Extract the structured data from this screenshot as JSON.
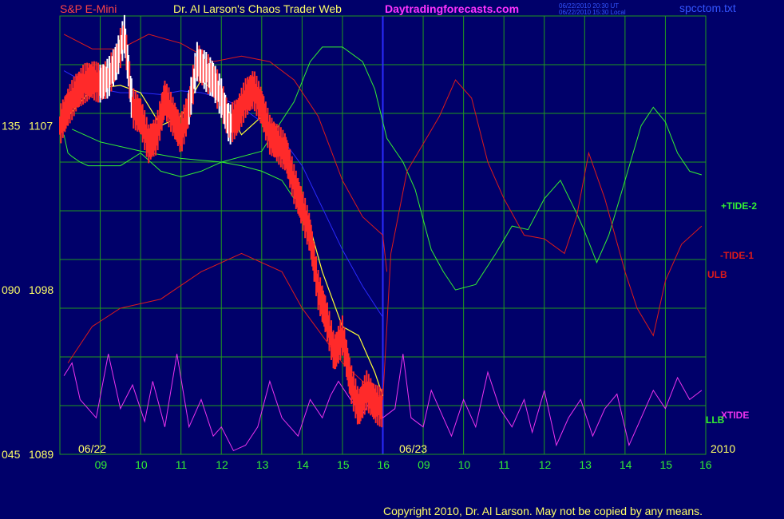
{
  "header": {
    "symbol": "S&P E-Mini",
    "title": "Dr. Al Larson's Chaos Trader Web",
    "site": "Daytradingforecasts.com",
    "stamp_ut": "06/22/2010 20:30 UT",
    "stamp_local": "06/22/2010 15:30 Local",
    "file": "spcctom.txt"
  },
  "footer": {
    "copyright": "Copyright 2010, Dr. Al Larson. May not be copied by any means."
  },
  "colors": {
    "background": "#00006a",
    "grid": "#1f9a1f",
    "frame": "#2a2aff",
    "price": "#ff2a2a",
    "price_up": "#ffffff",
    "yellow": "#ffff33",
    "green": "#33ee33",
    "red": "#dd1a1a",
    "blue": "#2a2aff",
    "magenta": "#ee33ee",
    "header_red": "#ff4444",
    "header_yellow": "#ffff66",
    "header_magenta": "#ff33ff",
    "header_blue": "#3355ff"
  },
  "chart_data": {
    "type": "line",
    "y_ticks": [
      {
        "left": "135",
        "right": "1107"
      },
      {
        "left": "090",
        "right": "1098"
      },
      {
        "left": "045",
        "right": "1089"
      }
    ],
    "y_range": [
      1089,
      1113
    ],
    "x_ticks": [
      "09",
      "10",
      "11",
      "12",
      "13",
      "14",
      "15",
      "16",
      "09",
      "10",
      "11",
      "12",
      "13",
      "14",
      "15",
      "16"
    ],
    "date_labels": [
      "06/22",
      "06/23"
    ],
    "year_label": "2010",
    "series_labels": [
      {
        "text": "+TIDE-2",
        "color": "green"
      },
      {
        "text": "-TIDE-1",
        "color": "red"
      },
      {
        "text": "ULB",
        "color": "red"
      },
      {
        "text": "XTIDE",
        "color": "magenta"
      },
      {
        "text": "LLB",
        "color": "green"
      }
    ],
    "x_range": [
      0,
      16
    ],
    "series": [
      {
        "name": "+TIDE-2",
        "color": "green",
        "x": [
          0.3,
          1,
          2,
          3,
          4,
          5,
          5.8,
          6.2,
          6.5,
          7,
          7.5,
          7.8,
          8.1,
          8.5,
          8.8,
          9.2,
          9.5,
          9.8,
          10.3,
          10.8,
          11.2,
          11.6,
          12.0,
          12.4,
          12.8,
          13.0,
          13.3,
          13.6,
          14.0,
          14.4,
          14.7,
          15.0,
          15.3,
          15.6,
          15.9
        ],
        "y": [
          1106.8,
          1106.1,
          1105.6,
          1105.2,
          1105.0,
          1105.6,
          1108.3,
          1110.5,
          1111.3,
          1111.3,
          1110.5,
          1109.0,
          1106.3,
          1105.0,
          1103.5,
          1100.2,
          1099.0,
          1098.0,
          1098.3,
          1100.0,
          1101.5,
          1101.3,
          1103.0,
          1104.0,
          1102.2,
          1101.2,
          1099.5,
          1101.0,
          1104.0,
          1107.0,
          1108.0,
          1107.2,
          1105.5,
          1104.5,
          1104.3
        ]
      },
      {
        "name": "-TIDE-1",
        "color": "red",
        "x": [
          0.2,
          0.8,
          1.5,
          2.5,
          3.5,
          4.5,
          5.5,
          6,
          6.5,
          7,
          7.5,
          8,
          8.2,
          8.6,
          9.0,
          9.4,
          9.8,
          10.2,
          10.6,
          11.0,
          11.5,
          12.0,
          12.5,
          12.8,
          13.1,
          13.5,
          14.0,
          14.3,
          14.7,
          15.0,
          15.4,
          15.9
        ],
        "y": [
          1094.0,
          1096.0,
          1097.0,
          1097.5,
          1099.0,
          1100.0,
          1099.0,
          1097.0,
          1095.5,
          1094.0,
          1093.0,
          1092.0,
          1100.0,
          1104.5,
          1106.0,
          1107.5,
          1109.5,
          1108.5,
          1105.0,
          1103.0,
          1101.0,
          1100.8,
          1100.0,
          1102.0,
          1105.5,
          1103.0,
          1099.0,
          1097.0,
          1095.5,
          1098.5,
          1100.5,
          1101.5
        ]
      },
      {
        "name": "ULB",
        "color": "red",
        "x": [
          0.1,
          0.8,
          1.5,
          2.2,
          3.0,
          3.8,
          4.5,
          5.2,
          5.8,
          6.4,
          7.0,
          7.5,
          8.0,
          8.1
        ],
        "y": [
          1112.0,
          1111.2,
          1111.2,
          1112.0,
          1111.5,
          1110.5,
          1110.8,
          1110.5,
          1109.5,
          1107.5,
          1104.0,
          1102.0,
          1101.0,
          1099.0
        ]
      },
      {
        "name": "LLB",
        "color": "green",
        "x": [
          0.1,
          0.2,
          0.3,
          0.5,
          0.7,
          1,
          1.5,
          2.0,
          2.5,
          3.0,
          3.5,
          4.0,
          4.5,
          5.0,
          5.5,
          5.8
        ],
        "y": [
          1106.5,
          1105.5,
          1105.3,
          1105.0,
          1104.8,
          1104.8,
          1104.8,
          1105.5,
          1104.5,
          1104.2,
          1104.5,
          1105.0,
          1104.8,
          1104.5,
          1104.0,
          1103.0
        ]
      },
      {
        "name": "blue",
        "color": "blue",
        "x": [
          0.1,
          0.5,
          1,
          1.5,
          2,
          2.5,
          3,
          3.5,
          4,
          4.5,
          5,
          5.5,
          6,
          6.5,
          7,
          7.5,
          8
        ],
        "y": [
          1110.0,
          1109.5,
          1109.0,
          1108.8,
          1108.8,
          1108.7,
          1108.9,
          1108.8,
          1108.5,
          1108.0,
          1107.2,
          1106.3,
          1104.8,
          1102.5,
          1100.2,
          1098.2,
          1096.5
        ]
      },
      {
        "name": "XTIDE",
        "color": "magenta",
        "x": [
          0.1,
          0.3,
          0.5,
          0.9,
          1.2,
          1.5,
          1.8,
          2.1,
          2.3,
          2.6,
          2.9,
          3.2,
          3.5,
          3.8,
          4.0,
          4.3,
          4.6,
          4.9,
          5.2,
          5.5,
          5.9,
          6.2,
          6.5,
          6.7,
          6.9,
          7.2,
          7.5,
          7.8,
          8.0,
          8.3,
          8.5,
          8.7,
          9.0,
          9.2,
          9.5,
          9.7,
          10.0,
          10.3,
          10.6,
          10.9,
          11.2,
          11.5,
          11.7,
          12.0,
          12.3,
          12.6,
          12.9,
          13.2,
          13.5,
          13.8,
          14.1,
          14.4,
          14.7,
          15.0,
          15.3,
          15.6,
          15.9
        ],
        "y": [
          1093.3,
          1094.0,
          1092.0,
          1091.0,
          1094.5,
          1091.5,
          1092.8,
          1090.8,
          1093.0,
          1090.5,
          1094.5,
          1090.5,
          1092.0,
          1090.0,
          1090.5,
          1089.2,
          1089.5,
          1090.5,
          1093.0,
          1091.0,
          1090.0,
          1092.0,
          1091.0,
          1092.2,
          1093.0,
          1092.0,
          1091.2,
          1092.3,
          1091.0,
          1091.5,
          1094.5,
          1091.0,
          1090.5,
          1092.5,
          1091.0,
          1090.0,
          1092.0,
          1090.5,
          1093.5,
          1091.5,
          1090.5,
          1092.0,
          1090.2,
          1092.5,
          1089.5,
          1091.0,
          1092.0,
          1090.0,
          1091.5,
          1092.3,
          1089.5,
          1091.0,
          1092.5,
          1091.5,
          1093.2,
          1092.0,
          1092.5
        ]
      },
      {
        "name": "price_avg",
        "color": "yellow",
        "x": [
          0.2,
          0.8,
          1.5,
          2.0,
          2.5,
          3.0,
          3.5,
          4.0,
          4.5,
          5.0,
          5.5,
          6.0,
          6.5,
          7.0,
          7.4,
          7.8,
          8.0
        ],
        "y": [
          1107.5,
          1109.0,
          1109.2,
          1108.8,
          1107.0,
          1107.5,
          1109.5,
          1108.5,
          1106.5,
          1107.5,
          1105.5,
          1103.0,
          1099.0,
          1096.0,
          1095.5,
          1093.5,
          1092.2
        ]
      }
    ],
    "price": {
      "x": [
        0,
        0.2,
        0.4,
        0.6,
        0.8,
        1.0,
        1.2,
        1.4,
        1.6,
        1.8,
        2.0,
        2.2,
        2.4,
        2.6,
        2.8,
        3.0,
        3.2,
        3.4,
        3.6,
        3.8,
        4.0,
        4.2,
        4.4,
        4.6,
        4.8,
        5.0,
        5.2,
        5.4,
        5.6,
        5.8,
        6.0,
        6.2,
        6.4,
        6.6,
        6.8,
        7.0,
        7.2,
        7.4,
        7.6,
        7.8,
        8.0
      ],
      "y": [
        1107.0,
        1108.0,
        1108.8,
        1109.3,
        1109.5,
        1109.3,
        1109.6,
        1110.5,
        1112.0,
        1108.0,
        1107.5,
        1106.0,
        1106.5,
        1108.5,
        1107.5,
        1106.5,
        1108.0,
        1110.5,
        1110.0,
        1109.5,
        1108.5,
        1107.0,
        1107.5,
        1108.5,
        1109.0,
        1108.0,
        1106.5,
        1106.0,
        1105.5,
        1103.8,
        1102.5,
        1101.0,
        1098.0,
        1096.5,
        1094.5,
        1095.5,
        1093.0,
        1091.5,
        1092.5,
        1091.8,
        1091.5
      ],
      "up_start": 1.0,
      "up_end": 1.8,
      "up_start2": 3.2,
      "up_end2": 4.3
    }
  }
}
